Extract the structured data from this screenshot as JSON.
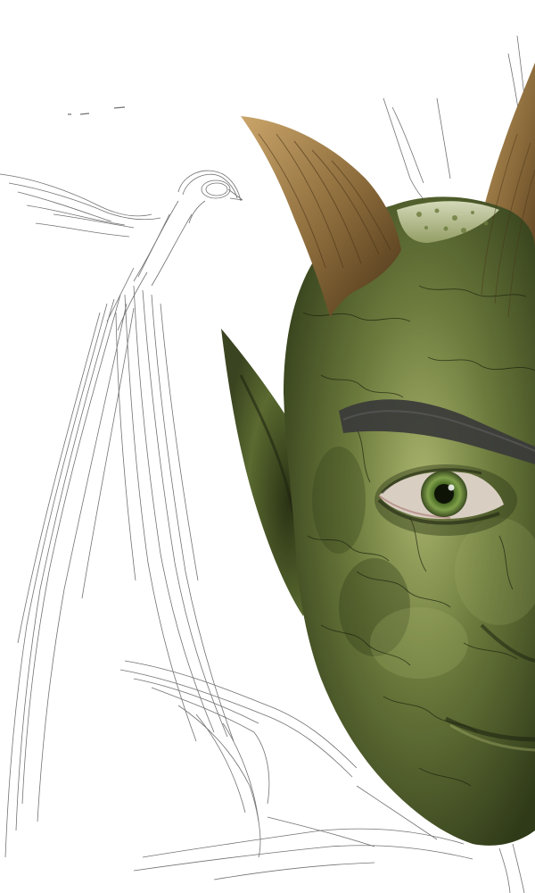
{
  "artwork": {
    "background_color": "#ffffff",
    "sketch_stroke_color": "#5a5a5a",
    "skin_base_color": "#6b7a3c",
    "skin_dark_color": "#2f3a18",
    "skin_light_color": "#a9b46d",
    "horn_color": "#8a6a3a",
    "horn_tip_color": "#caa56a",
    "eye_iris_color": "#7fa04a",
    "brow_color": "#3a3a3a"
  }
}
